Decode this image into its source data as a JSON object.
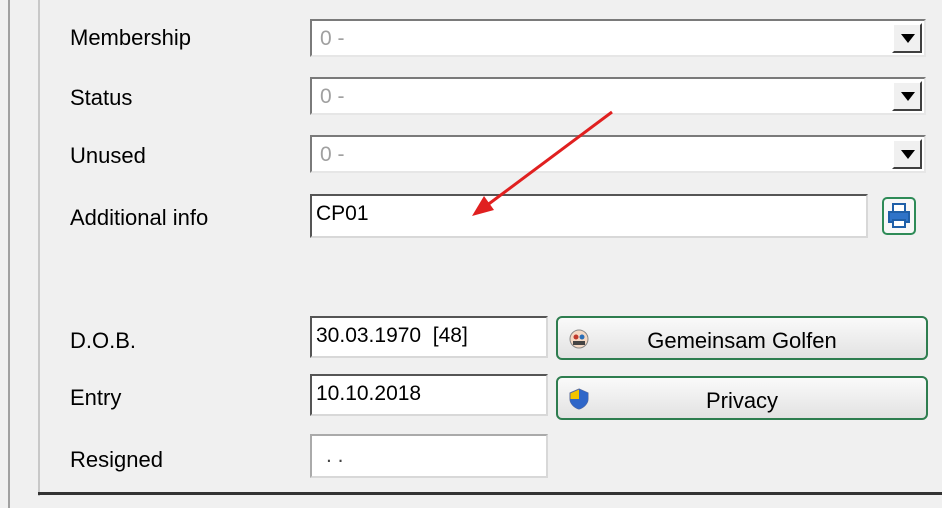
{
  "fields": {
    "membership": {
      "label": "Membership",
      "value": "0 -"
    },
    "status": {
      "label": "Status",
      "value": "0 -"
    },
    "unused": {
      "label": "Unused",
      "value": "0 -"
    },
    "additional_info": {
      "label": "Additional info",
      "value": "CP01"
    },
    "dob": {
      "label": "D.O.B.",
      "value": "30.03.1970  [48]"
    },
    "entry": {
      "label": "Entry",
      "value": "10.10.2018"
    },
    "resigned": {
      "label": "Resigned",
      "value": ". ."
    }
  },
  "buttons": {
    "gemeinsam_golfen": "Gemeinsam Golfen",
    "privacy": "Privacy"
  },
  "icons": {
    "dropdown": "chevron-down-icon",
    "print": "printer-icon",
    "golf": "golf-group-icon",
    "privacy": "shield-icon"
  },
  "colors": {
    "button_border": "#2e7d4f",
    "annotation_arrow": "#e02020"
  }
}
